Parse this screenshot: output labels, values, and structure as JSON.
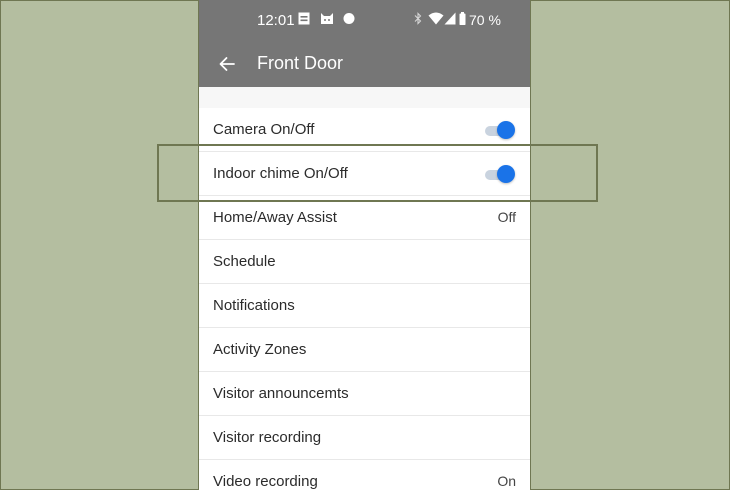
{
  "status_bar": {
    "time": "12:01",
    "battery": "70 %",
    "icons": [
      "calendar-icon",
      "cat-icon",
      "dot-icon",
      "bluetooth-icon",
      "wifi-icon",
      "signal-icon",
      "battery-icon"
    ]
  },
  "app_bar": {
    "title": "Front Door",
    "back_icon": "arrow-left-icon"
  },
  "settings": [
    {
      "label": "Camera On/Off",
      "type": "toggle",
      "on": true
    },
    {
      "label": "Indoor chime On/Off",
      "type": "toggle",
      "on": true
    },
    {
      "label": "Home/Away Assist",
      "type": "value",
      "value": "Off"
    },
    {
      "label": "Schedule",
      "type": "nav"
    },
    {
      "label": "Notifications",
      "type": "nav"
    },
    {
      "label": "Activity Zones",
      "type": "nav"
    },
    {
      "label": "Visitor announcemts",
      "type": "nav"
    },
    {
      "label": "Visitor recording",
      "type": "nav"
    },
    {
      "label": "Video recording",
      "type": "value",
      "value": "On"
    }
  ],
  "colors": {
    "backdrop": "#b4bea0",
    "frame": "#6f7752",
    "app_bar": "#767676",
    "toggle_on": "#1a73e8"
  }
}
